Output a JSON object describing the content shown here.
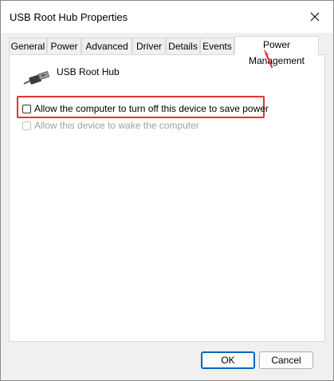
{
  "window": {
    "title": "USB Root Hub Properties"
  },
  "tabs": [
    {
      "label": "General"
    },
    {
      "label": "Power"
    },
    {
      "label": "Advanced"
    },
    {
      "label": "Driver"
    },
    {
      "label": "Details"
    },
    {
      "label": "Events"
    },
    {
      "label": "Power Management",
      "active": true
    }
  ],
  "device": {
    "name": "USB Root Hub",
    "icon": "usb-cable-icon"
  },
  "options": [
    {
      "label": "Allow the computer to turn off this device to save power",
      "checked": false,
      "enabled": true
    },
    {
      "label": "Allow this device to wake the computer",
      "checked": false,
      "enabled": false
    }
  ],
  "buttons": {
    "ok": "OK",
    "cancel": "Cancel"
  },
  "colors": {
    "highlight": "#e63232",
    "arrow": "#e63232",
    "ok_border": "#0067c0"
  }
}
